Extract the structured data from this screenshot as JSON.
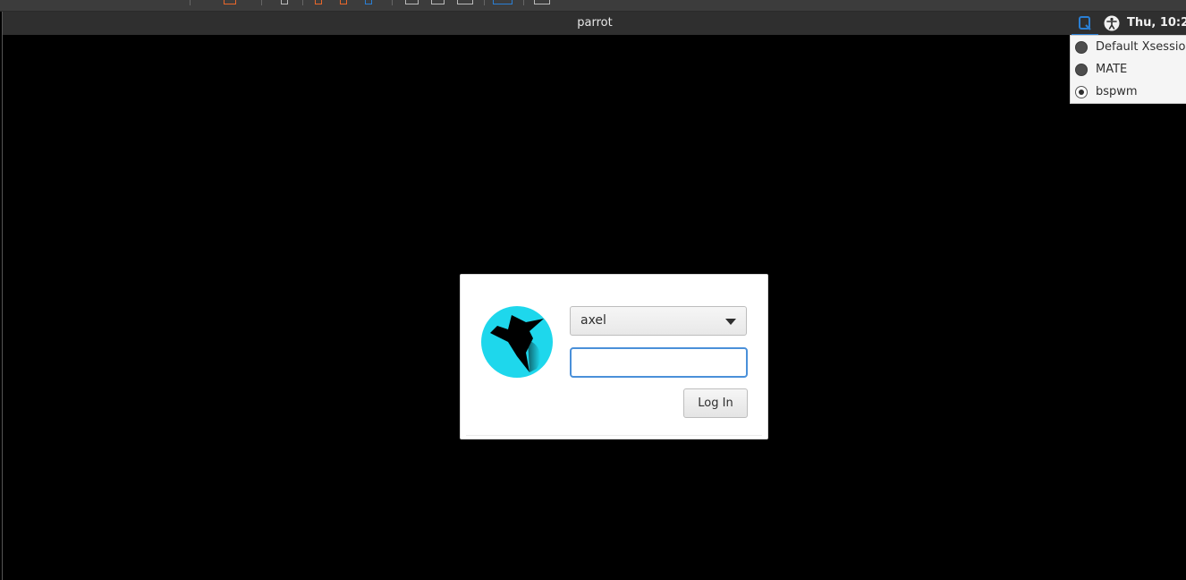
{
  "panel": {
    "hostname": "parrot",
    "clock": "Thu, 10:2"
  },
  "session_menu": {
    "items": [
      {
        "label": "Default Xsession",
        "selected": false
      },
      {
        "label": "MATE",
        "selected": false
      },
      {
        "label": "bspwm",
        "selected": true
      }
    ]
  },
  "login": {
    "user": "axel",
    "password_value": "",
    "login_label": "Log In"
  },
  "colors": {
    "logo_circle": "#1ed7ec",
    "focus_accent": "#4a90d9",
    "panel_bg": "#2f2f2f",
    "toolbar_orange": "#e8662a"
  }
}
